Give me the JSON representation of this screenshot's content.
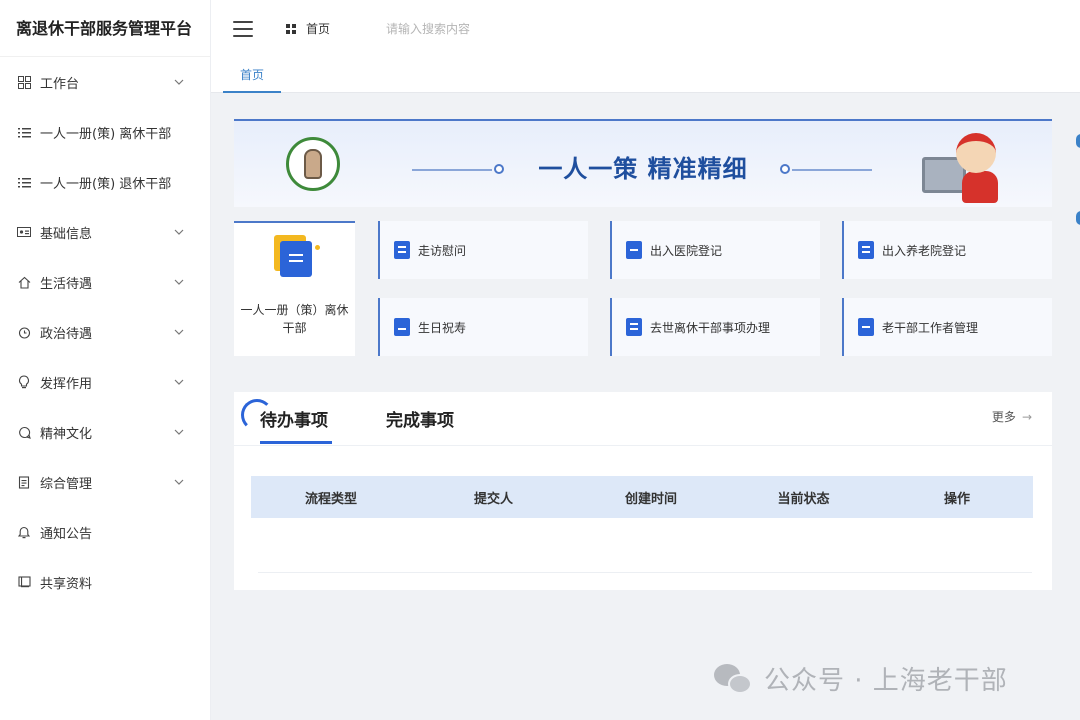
{
  "app": {
    "title": "离退休干部服务管理平台"
  },
  "sidebar": {
    "items": [
      {
        "label": "工作台",
        "icon": "dashboard-icon",
        "has_submenu": true
      },
      {
        "label": "一人一册(策) 离休干部",
        "icon": "list-icon",
        "has_submenu": false
      },
      {
        "label": "一人一册(策) 退休干部",
        "icon": "list-icon",
        "has_submenu": false
      },
      {
        "label": "基础信息",
        "icon": "id-card-icon",
        "has_submenu": true
      },
      {
        "label": "生活待遇",
        "icon": "house-icon",
        "has_submenu": true
      },
      {
        "label": "政治待遇",
        "icon": "clock-icon",
        "has_submenu": true
      },
      {
        "label": "发挥作用",
        "icon": "lightbulb-icon",
        "has_submenu": true
      },
      {
        "label": "精神文化",
        "icon": "chat-icon",
        "has_submenu": true
      },
      {
        "label": "综合管理",
        "icon": "document-icon",
        "has_submenu": true
      },
      {
        "label": "通知公告",
        "icon": "bell-icon",
        "has_submenu": false
      },
      {
        "label": "共享资料",
        "icon": "book-icon",
        "has_submenu": false
      }
    ]
  },
  "header": {
    "breadcrumb": "首页",
    "search_placeholder": "请输入搜索内容"
  },
  "tabs": {
    "active": "首页"
  },
  "banner": {
    "title": "一人一策 精准精细"
  },
  "features": {
    "main_label": "一人一册（策）离休干部",
    "cards": [
      {
        "label": "走访慰问",
        "icon": "edit-doc-icon"
      },
      {
        "label": "出入医院登记",
        "icon": "medical-doc-icon"
      },
      {
        "label": "出入养老院登记",
        "icon": "doc-icon"
      },
      {
        "label": "生日祝寿",
        "icon": "cake-icon"
      },
      {
        "label": "去世离休干部事项办理",
        "icon": "doc-icon"
      },
      {
        "label": "老干部工作者管理",
        "icon": "wallet-icon"
      }
    ]
  },
  "tasks": {
    "tab_pending": "待办事项",
    "tab_done": "完成事项",
    "more": "更多",
    "columns": [
      "流程类型",
      "提交人",
      "创建时间",
      "当前状态",
      "操作"
    ]
  },
  "watermark": {
    "text": "公众号 · 上海老干部"
  },
  "colors": {
    "accent": "#2b64d8",
    "brand_blue": "#1f4f9e",
    "tab_active": "#3b82c8"
  }
}
